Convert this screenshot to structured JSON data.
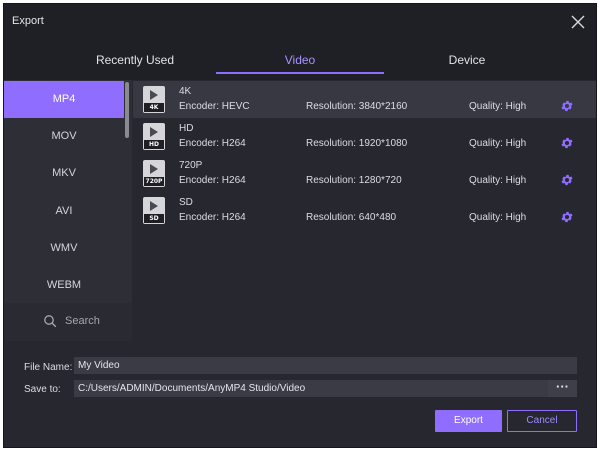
{
  "window": {
    "title": "Export"
  },
  "tabs": [
    {
      "label": "Recently Used"
    },
    {
      "label": "Video"
    },
    {
      "label": "Device"
    }
  ],
  "formats": [
    {
      "label": "MP4"
    },
    {
      "label": "MOV"
    },
    {
      "label": "MKV"
    },
    {
      "label": "AVI"
    },
    {
      "label": "WMV"
    },
    {
      "label": "WEBM"
    }
  ],
  "search": {
    "label": "Search"
  },
  "presets": [
    {
      "name": "4K",
      "badge": "4K",
      "encoder": "Encoder: HEVC",
      "resolution": "Resolution: 3840*2160",
      "quality": "Quality: High"
    },
    {
      "name": "HD",
      "badge": "HD",
      "encoder": "Encoder: H264",
      "resolution": "Resolution: 1920*1080",
      "quality": "Quality: High"
    },
    {
      "name": "720P",
      "badge": "720P",
      "encoder": "Encoder: H264",
      "resolution": "Resolution: 1280*720",
      "quality": "Quality: High"
    },
    {
      "name": "SD",
      "badge": "SD",
      "encoder": "Encoder: H264",
      "resolution": "Resolution: 640*480",
      "quality": "Quality: High"
    }
  ],
  "output": {
    "file_name_label": "File Name:",
    "file_name_value": "My Video",
    "save_to_label": "Save to:",
    "save_to_value": "C:/Users/ADMIN/Documents/AnyMP4 Studio/Video",
    "browse_label": "···"
  },
  "actions": {
    "export_label": "Export",
    "cancel_label": "Cancel"
  },
  "colors": {
    "accent": "#8f6dff",
    "background": "#27272f",
    "titlebar": "#1f1f26"
  }
}
